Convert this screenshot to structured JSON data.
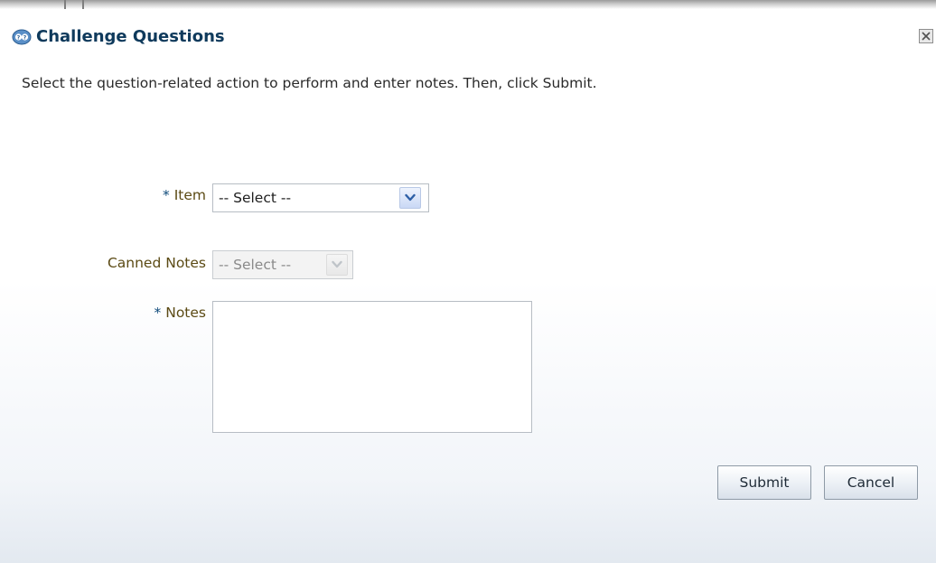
{
  "dialog": {
    "title": "Challenge Questions",
    "title_icon": "question-bubbles-icon",
    "close_icon": "close-icon",
    "instruction": "Select the question-related action to perform and enter notes. Then, click Submit."
  },
  "form": {
    "item": {
      "required_marker": "*",
      "label": "Item",
      "selected_value": "-- Select --"
    },
    "canned_notes": {
      "label": "Canned Notes",
      "selected_value": "-- Select --",
      "disabled": true
    },
    "notes": {
      "required_marker": "*",
      "label": "Notes",
      "value": ""
    }
  },
  "buttons": {
    "submit_label": "Submit",
    "cancel_label": "Cancel"
  },
  "colors": {
    "title": "#0f3a5c",
    "label": "#5b4a14",
    "required_marker": "#0e4a7a"
  }
}
